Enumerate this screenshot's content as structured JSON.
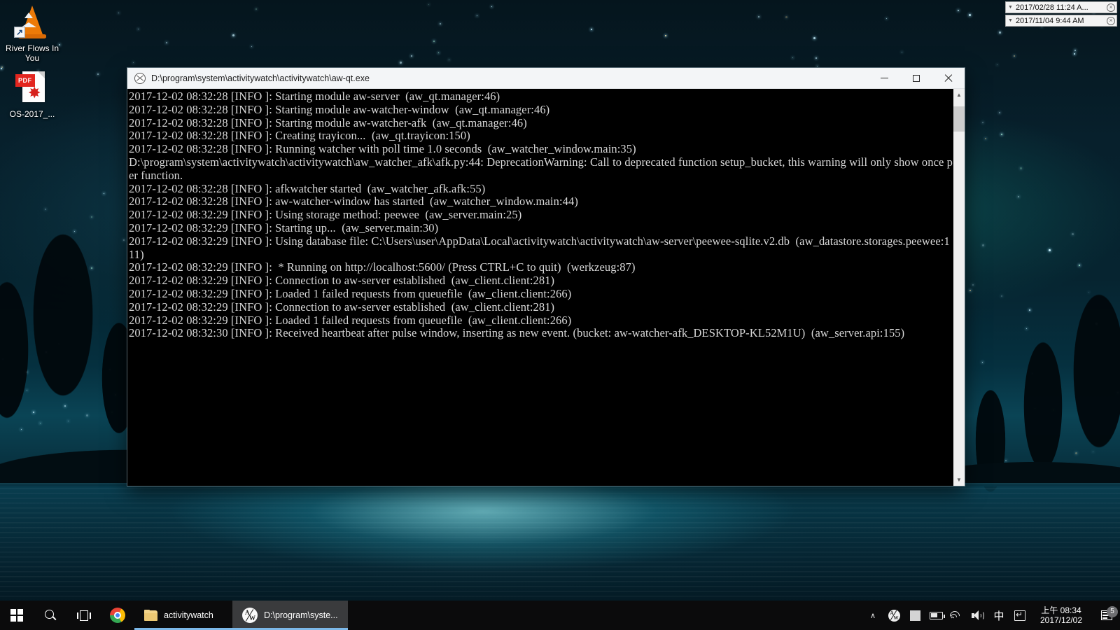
{
  "desktop": {
    "icons": [
      {
        "name": "vlc-shortcut",
        "label": "River Flows\nIn You",
        "type": "vlc-shortcut-icon"
      },
      {
        "name": "pdf-file",
        "label": "OS-2017_...",
        "type": "pdf-file-icon",
        "badge": "PDF"
      }
    ],
    "date_widgets": [
      {
        "text": "2017/02/28 11:24 A...",
        "close": "×",
        "caret": "▼"
      },
      {
        "text": "2017/11/04 9:44 AM",
        "close": "×",
        "caret": "▼"
      }
    ]
  },
  "console_window": {
    "title": "D:\\program\\system\\activitywatch\\activitywatch\\aw-qt.exe",
    "icon": "aw-qt-icon",
    "controls": {
      "minimize": "–",
      "maximize": "□",
      "close": "×"
    },
    "scrollbar": {
      "up": "▲",
      "down": "▼"
    },
    "lines": [
      "2017-12-02 08:32:28 [INFO ]: Starting module aw-server  (aw_qt.manager:46)",
      "2017-12-02 08:32:28 [INFO ]: Starting module aw-watcher-window  (aw_qt.manager:46)",
      "2017-12-02 08:32:28 [INFO ]: Starting module aw-watcher-afk  (aw_qt.manager:46)",
      "2017-12-02 08:32:28 [INFO ]: Creating trayicon...  (aw_qt.trayicon:150)",
      "2017-12-02 08:32:28 [INFO ]: Running watcher with poll time 1.0 seconds  (aw_watcher_window.main:35)",
      "D:\\program\\system\\activitywatch\\activitywatch\\aw_watcher_afk\\afk.py:44: DeprecationWarning: Call to deprecated function setup_bucket, this warning will only show once per function.",
      "2017-12-02 08:32:28 [INFO ]: afkwatcher started  (aw_watcher_afk.afk:55)",
      "2017-12-02 08:32:28 [INFO ]: aw-watcher-window has started  (aw_watcher_window.main:44)",
      "2017-12-02 08:32:29 [INFO ]: Using storage method: peewee  (aw_server.main:25)",
      "2017-12-02 08:32:29 [INFO ]: Starting up...  (aw_server.main:30)",
      "2017-12-02 08:32:29 [INFO ]: Using database file: C:\\Users\\user\\AppData\\Local\\activitywatch\\activitywatch\\aw-server\\peewee-sqlite.v2.db  (aw_datastore.storages.peewee:111)",
      "2017-12-02 08:32:29 [INFO ]:  * Running on http://localhost:5600/ (Press CTRL+C to quit)  (werkzeug:87)",
      "2017-12-02 08:32:29 [INFO ]: Connection to aw-server established  (aw_client.client:281)",
      "2017-12-02 08:32:29 [INFO ]: Loaded 1 failed requests from queuefile  (aw_client.client:266)",
      "2017-12-02 08:32:29 [INFO ]: Connection to aw-server established  (aw_client.client:281)",
      "2017-12-02 08:32:29 [INFO ]: Loaded 1 failed requests from queuefile  (aw_client.client:266)",
      "2017-12-02 08:32:30 [INFO ]: Received heartbeat after pulse window, inserting as new event. (bucket: aw-watcher-afk_DESKTOP-KL52M1U)  (aw_server.api:155)"
    ]
  },
  "taskbar": {
    "start": {
      "name": "start-button",
      "icon": "windows-logo-icon"
    },
    "search": {
      "name": "search-button",
      "icon": "search-icon"
    },
    "taskview": {
      "name": "task-view-button",
      "icon": "task-view-icon"
    },
    "pinned": [
      {
        "label": "",
        "icon": "chrome-icon",
        "name": "taskbar-chrome"
      }
    ],
    "tasks": [
      {
        "label": "activitywatch",
        "icon": "folder-icon",
        "name": "taskbar-activitywatch",
        "active": false
      },
      {
        "label": "D:\\program\\syste...",
        "icon": "aw-qt-icon",
        "name": "taskbar-aw-qt",
        "active": true
      }
    ],
    "tray": {
      "chevron": "∧",
      "items": [
        {
          "name": "tray-aw-icon",
          "icon": "aw-qt-icon"
        },
        {
          "name": "tray-unknown-icon",
          "icon": "square-icon"
        },
        {
          "name": "tray-battery-icon",
          "icon": "battery-icon"
        },
        {
          "name": "tray-network-icon",
          "icon": "wifi-icon"
        },
        {
          "name": "tray-volume-icon",
          "icon": "speaker-icon"
        },
        {
          "name": "tray-ime-icon",
          "icon": "ime-chinese-icon",
          "glyph": "中"
        },
        {
          "name": "tray-ime-mode-icon",
          "icon": "ime-mode-icon"
        }
      ]
    },
    "clock": {
      "time": "上午 08:34",
      "date": "2017/12/02"
    },
    "action_center": {
      "name": "action-center-button",
      "badge": "5"
    }
  }
}
